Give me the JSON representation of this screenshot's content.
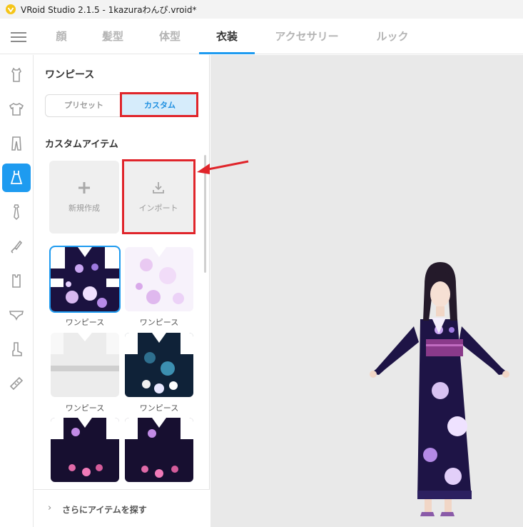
{
  "window": {
    "title": "VRoid Studio 2.1.5 - 1kazuraわんぴ.vroid*",
    "app_icon": "vroid-logo-icon"
  },
  "topnav": {
    "menu_icon": "hamburger-menu-icon",
    "tabs": [
      {
        "label": "顔",
        "active": false
      },
      {
        "label": "髪型",
        "active": false
      },
      {
        "label": "体型",
        "active": false
      },
      {
        "label": "衣装",
        "active": true
      },
      {
        "label": "アクセサリー",
        "active": false
      },
      {
        "label": "ルック",
        "active": false
      }
    ]
  },
  "sidebar": {
    "categories": [
      {
        "icon": "inner-shirt-icon",
        "active": false
      },
      {
        "icon": "tshirt-icon",
        "active": false
      },
      {
        "icon": "pants-icon",
        "active": false
      },
      {
        "icon": "onepiece-dress-icon",
        "active": true
      },
      {
        "icon": "necktie-icon",
        "active": false
      },
      {
        "icon": "glove-icon",
        "active": false
      },
      {
        "icon": "legwear-icon",
        "active": false
      },
      {
        "icon": "underwear-icon",
        "active": false
      },
      {
        "icon": "boot-icon",
        "active": false
      },
      {
        "icon": "accessory-icon",
        "active": false
      }
    ]
  },
  "panel": {
    "title": "ワンピース",
    "segments": {
      "preset": "プリセット",
      "custom": "カスタム",
      "active": "custom"
    },
    "section_label": "カスタムアイテム",
    "actions": {
      "new_label": "新規作成",
      "new_icon": "plus-icon",
      "import_label": "インポート",
      "import_icon": "download-icon"
    },
    "items": [
      {
        "label": "ワンピース",
        "selected": true,
        "style": "navy-floral"
      },
      {
        "label": "ワンピース",
        "selected": false,
        "style": "white-pink"
      },
      {
        "label": "ワンピース",
        "selected": false,
        "style": "white-gray"
      },
      {
        "label": "ワンピース",
        "selected": false,
        "style": "teal-floral"
      },
      {
        "label": "",
        "selected": false,
        "style": "navy-pink"
      },
      {
        "label": "",
        "selected": false,
        "style": "navy-pink"
      }
    ],
    "more_label": "さらにアイテムを探す",
    "more_icon": "chevron-right-icon"
  },
  "annotations": {
    "highlight_color": "#e0252b",
    "arrow_icon": "red-arrow-icon"
  },
  "colors": {
    "accent": "#1e9bf0",
    "kimono": "#1e1446",
    "obi": "#8a3a8a"
  }
}
